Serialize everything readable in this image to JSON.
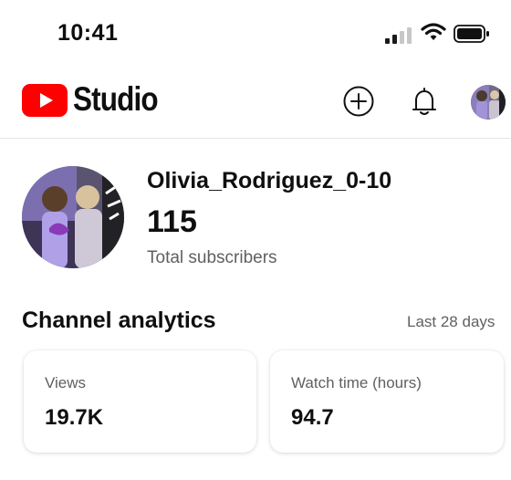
{
  "status_bar": {
    "time": "10:41"
  },
  "header": {
    "app_name": "Studio",
    "brand_color": "#ff0000",
    "icons": [
      "youtube-logo-icon",
      "add-icon",
      "bell-icon"
    ]
  },
  "channel": {
    "name": "Olivia_Rodriguez_0-10",
    "subscribers": "115",
    "subscribers_label": "Total subscribers"
  },
  "analytics": {
    "title": "Channel analytics",
    "period": "Last 28 days",
    "cards": [
      {
        "label": "Views",
        "value": "19.7K"
      },
      {
        "label": "Watch time (hours)",
        "value": "94.7"
      }
    ]
  }
}
